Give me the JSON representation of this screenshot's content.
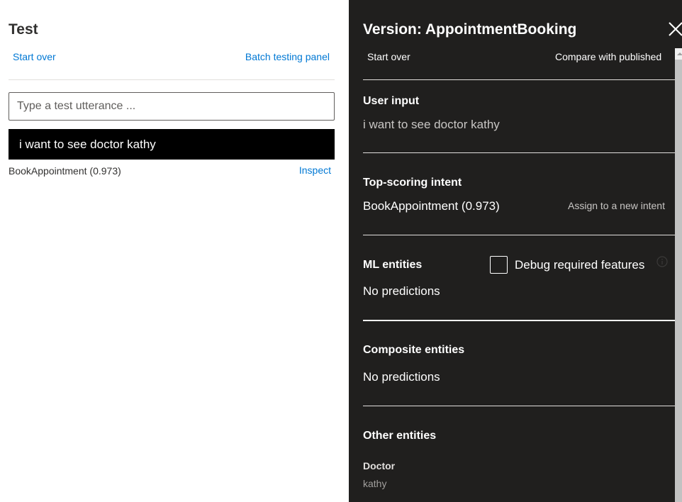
{
  "test_panel": {
    "title": "Test",
    "start_over": "Start over",
    "batch_testing": "Batch testing panel",
    "input_placeholder": "Type a test utterance ...",
    "input_value": "",
    "utterance": "i want to see doctor kathy",
    "top_intent": "BookAppointment (0.973)",
    "inspect": "Inspect"
  },
  "inspect_panel": {
    "title": "Version: AppointmentBooking",
    "close_icon": "close-icon",
    "start_over": "Start over",
    "compare": "Compare with published",
    "user_input": {
      "heading": "User input",
      "value": "i want to see doctor kathy"
    },
    "top_intent": {
      "heading": "Top-scoring intent",
      "value": "BookAppointment (0.973)",
      "assign": "Assign to a new intent"
    },
    "ml_entities": {
      "heading": "ML entities",
      "debug_label": "Debug required features",
      "debug_checked": false,
      "value": "No predictions"
    },
    "composite_entities": {
      "heading": "Composite entities",
      "value": "No predictions"
    },
    "other_entities": {
      "heading": "Other entities",
      "items": [
        {
          "name": "Doctor",
          "value": "kathy"
        }
      ]
    }
  }
}
